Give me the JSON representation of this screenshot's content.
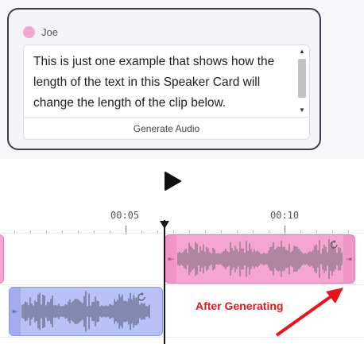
{
  "speaker_card": {
    "speaker_name": "Joe",
    "speaker_color": "#f4a6cf",
    "text": "This is just one example that shows how the length of the text in this Speaker Card will change the length of the clip below.",
    "generate_label": "Generate Audio"
  },
  "player": {
    "play_icon": "play-icon"
  },
  "timeline": {
    "ruler_labels": [
      "00:05",
      "00:10"
    ],
    "clips": [
      {
        "name": "pink-clip",
        "color": "#f4a6cf"
      },
      {
        "name": "blue-clip",
        "color": "#b8c2f7"
      }
    ],
    "regen_icon": "refresh-icon"
  },
  "annotation": {
    "text": "After Generating",
    "color": "#e8141c"
  }
}
